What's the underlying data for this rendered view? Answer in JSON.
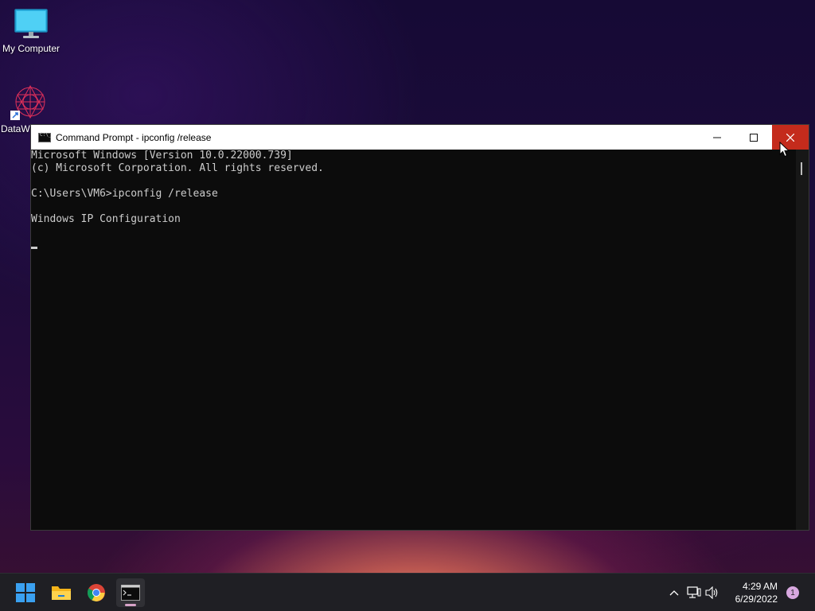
{
  "desktop": {
    "icons": [
      {
        "label": "My Computer",
        "icon": "monitor-icon"
      },
      {
        "label": "DataW",
        "icon": "datawarehouse-app-icon"
      }
    ]
  },
  "window": {
    "title": "Command Prompt - ipconfig  /release",
    "controls": {
      "minimize": "—",
      "maximize": "☐",
      "close": "✕"
    },
    "console_lines": [
      "Microsoft Windows [Version 10.0.22000.739]",
      "(c) Microsoft Corporation. All rights reserved.",
      "",
      "C:\\Users\\VM6>ipconfig /release",
      "",
      "Windows IP Configuration",
      ""
    ]
  },
  "taskbar": {
    "apps": [
      {
        "name": "start",
        "icon": "windows-logo-icon"
      },
      {
        "name": "file-explorer",
        "icon": "folder-icon"
      },
      {
        "name": "chrome",
        "icon": "chrome-icon"
      },
      {
        "name": "command-prompt",
        "icon": "terminal-icon",
        "active": true
      }
    ],
    "clock": {
      "time": "4:29 AM",
      "date": "6/29/2022"
    },
    "notification_count": "1"
  },
  "colors": {
    "close_button": "#c42b1c",
    "console_bg": "#0c0c0c",
    "console_text": "#cccccc",
    "taskbar_bg": "#1f1f24"
  }
}
